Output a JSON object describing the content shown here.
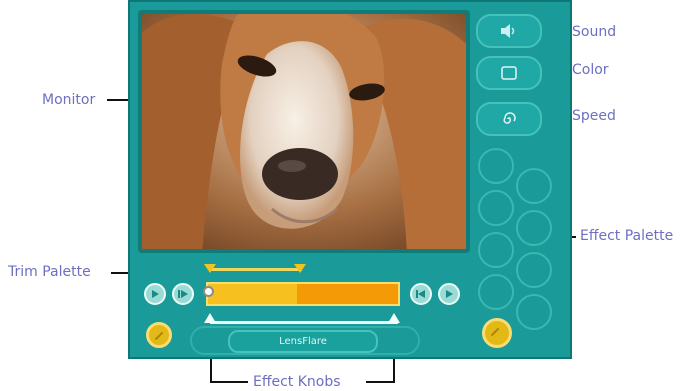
{
  "callouts": {
    "sound": "Sound",
    "color": "Color",
    "speed": "Speed",
    "monitor": "Monitor",
    "effect_palette": "Effect Palette",
    "trim_palette": "Trim Palette",
    "effect_knobs": "Effect Knobs"
  },
  "panel": {
    "effect_name": "LensFlare",
    "timeline_progress": 0.47,
    "icons": {
      "sound": "speaker-icon",
      "color": "color-swatch-icon",
      "speed": "spiral-icon"
    }
  },
  "colors": {
    "panel": "#1a9a98",
    "callout_text": "#6d6fc1",
    "timeline": "#f6c01f"
  }
}
